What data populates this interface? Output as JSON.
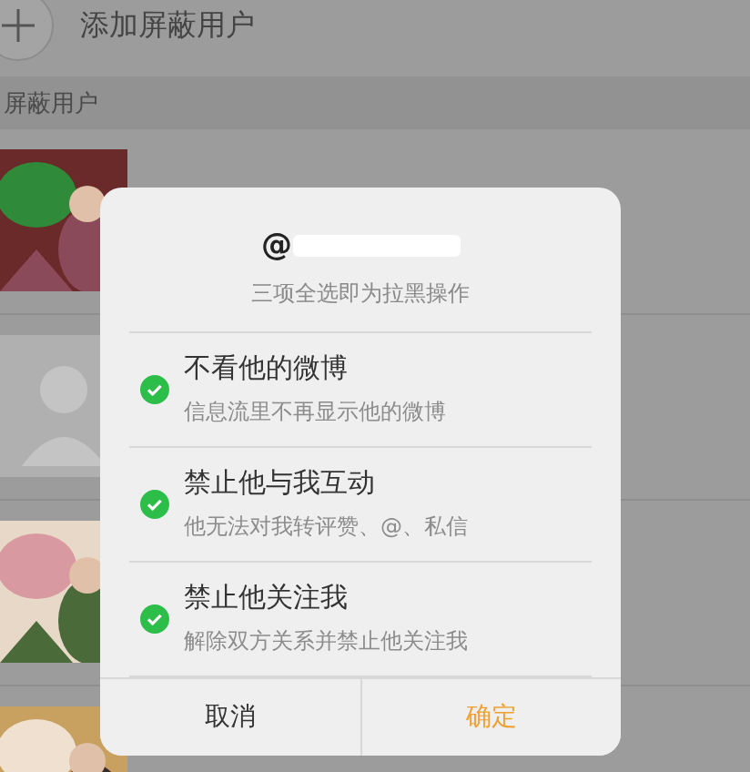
{
  "header": {
    "title": "添加屏蔽用户"
  },
  "section": {
    "title": "屏蔽用户"
  },
  "users": [
    {
      "kind": "picture"
    },
    {
      "kind": "placeholder"
    },
    {
      "kind": "picture"
    },
    {
      "kind": "picture"
    }
  ],
  "dialog": {
    "title": "@",
    "subtitle": "三项全选即为拉黑操作",
    "options": [
      {
        "label": "不看他的微博",
        "description": "信息流里不再显示他的微博",
        "checked": true
      },
      {
        "label": "禁止他与我互动",
        "description": "他无法对我转评赞、@、私信",
        "checked": true
      },
      {
        "label": "禁止他关注我",
        "description": "解除双方关系并禁止他关注我",
        "checked": true
      }
    ],
    "buttons": [
      {
        "label": "取消",
        "kind": "cancel"
      },
      {
        "label": "确定",
        "kind": "confirm"
      }
    ]
  }
}
